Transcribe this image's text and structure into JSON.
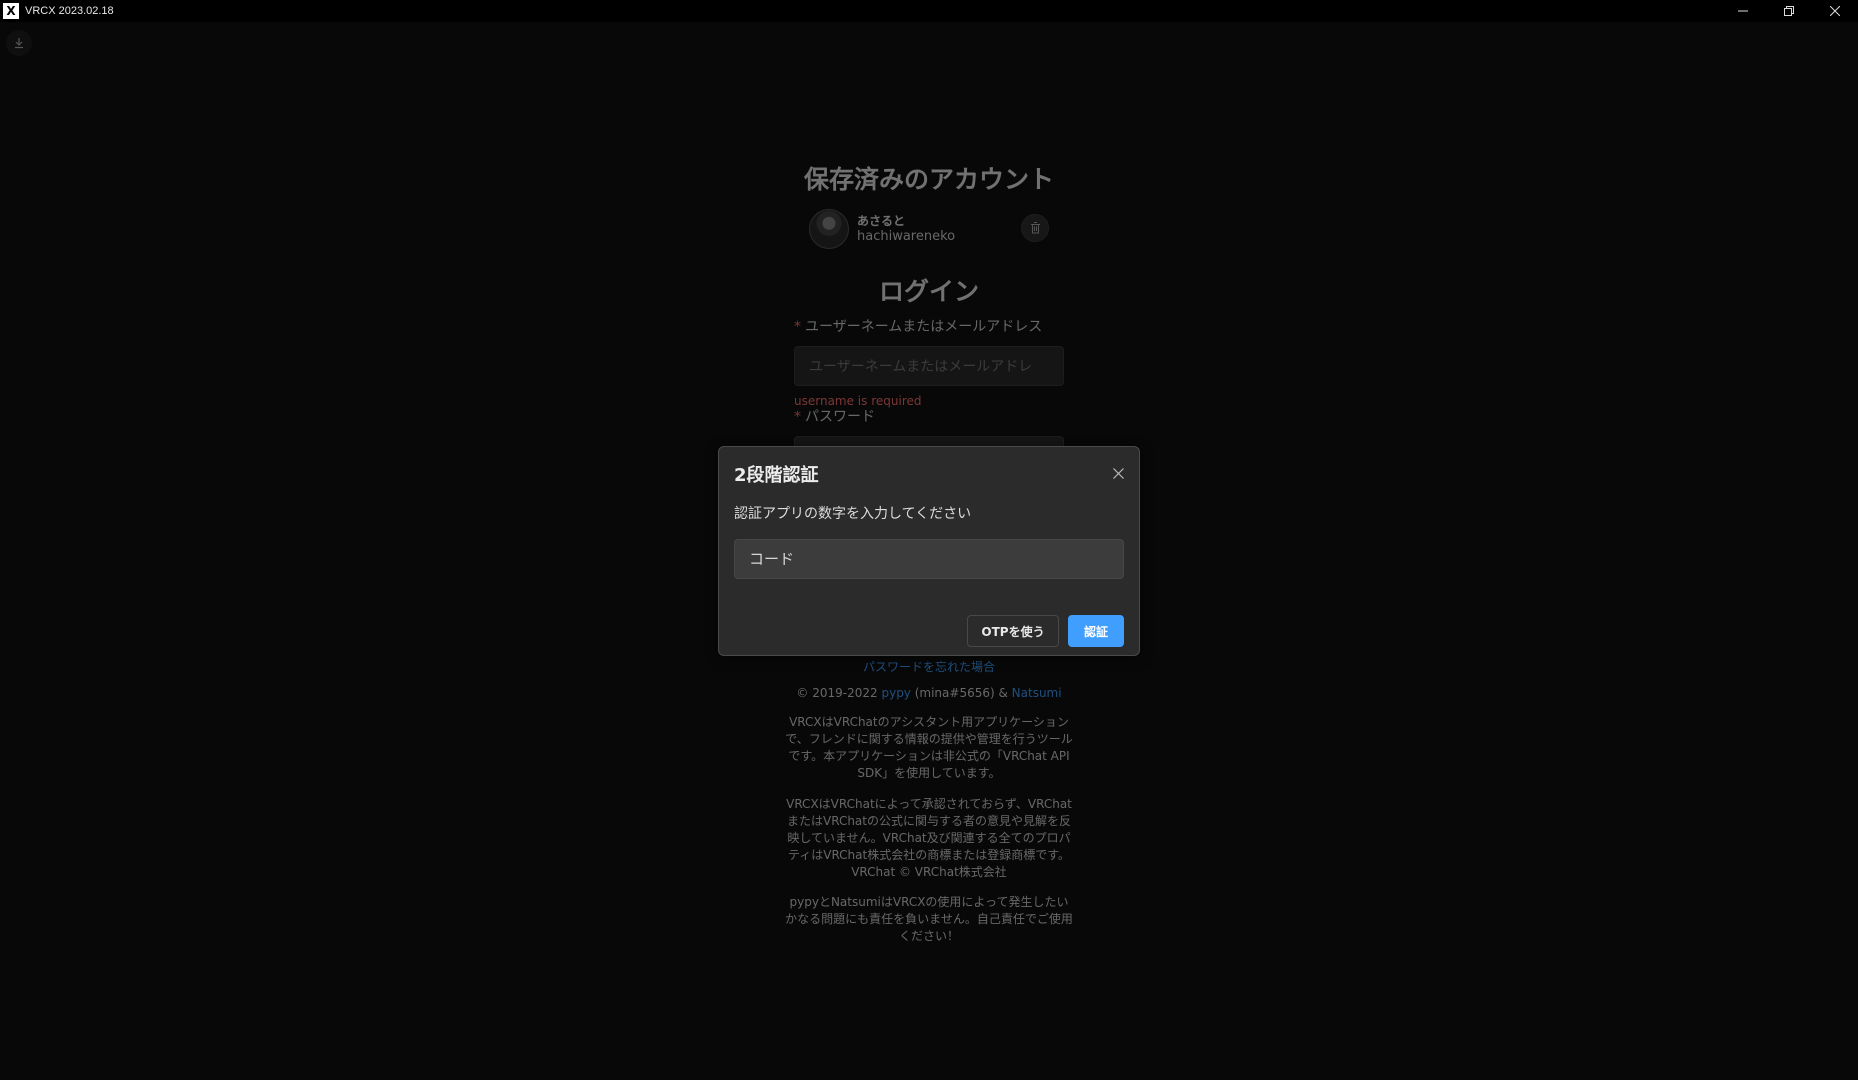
{
  "window": {
    "title": "VRCX 2023.02.18",
    "logo_text": "X",
    "controls": {
      "minimize_icon": "minimize-icon",
      "restore_icon": "restore-icon",
      "close_icon": "close-icon"
    }
  },
  "toolbar": {
    "download_icon": "download-icon"
  },
  "saved_accounts": {
    "heading": "保存済みのアカウント",
    "accounts": [
      {
        "display_name": "あさると",
        "username": "hachiwareneko",
        "delete_icon": "trash-icon"
      }
    ]
  },
  "login": {
    "heading": "ログイン",
    "required_mark": "*",
    "username_label": "ユーザーネームまたはメールアドレス",
    "username_placeholder": "ユーザーネームまたはメールアドレ",
    "username_error": "username is required",
    "password_label": "パスワード",
    "forgot_password": "パスワードを忘れた場合"
  },
  "footer": {
    "copyright_prefix": "© 2019-2022 ",
    "author1": "pypy",
    "author1_handle": " (mina#5656) & ",
    "author2": "Natsumi",
    "legal_1": "VRCXはVRChatのアシスタント用アプリケーションで、フレンドに関する情報の提供や管理を行うツールです。本アプリケーションは非公式の「VRChat API SDK」を使用しています。",
    "legal_2": "VRCXはVRChatによって承認されておらず、VRChatまたはVRChatの公式に関与する者の意見や見解を反映していません。VRChat及び関連する全てのプロパティはVRChat株式会社の商標または登録商標です。 VRChat © VRChat株式会社",
    "legal_3": "pypyとNatsumiはVRCXの使用によって発生したいかなる問題にも責任を負いません。自己責任でご使用ください！"
  },
  "dialog": {
    "title": "2段階認証",
    "description": "認証アプリの数字を入力してください",
    "code_placeholder": "コード",
    "code_value": "",
    "otp_button": "OTPを使う",
    "verify_button": "認証",
    "close_icon": "close-icon"
  },
  "colors": {
    "accent": "#409eff",
    "error": "#f56c6c",
    "background": "#101010"
  }
}
